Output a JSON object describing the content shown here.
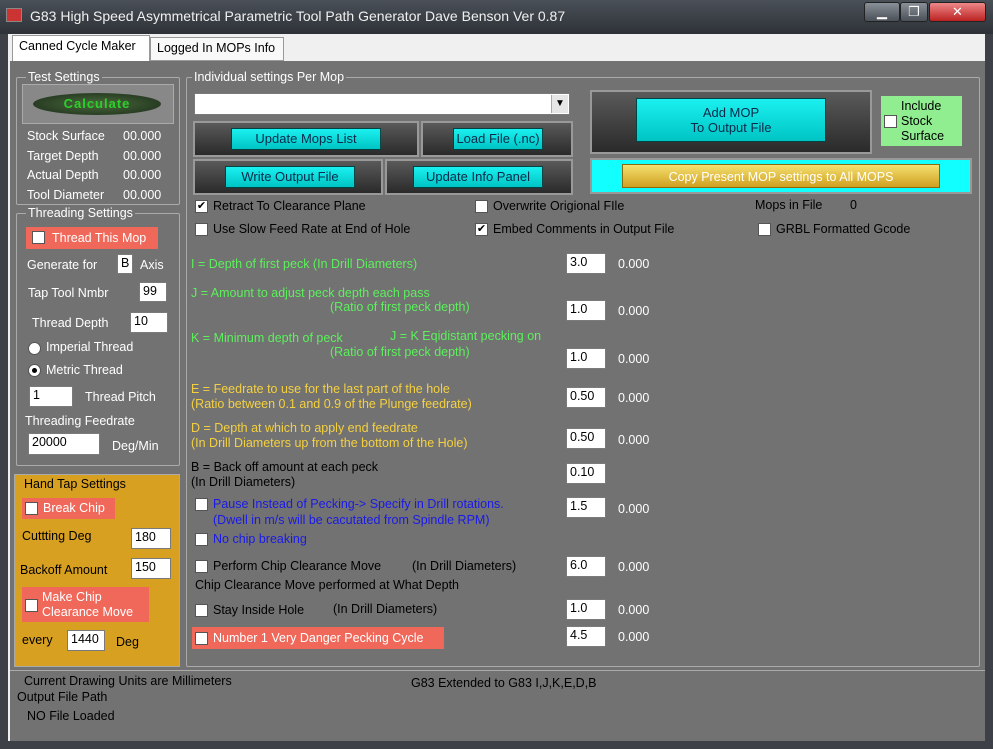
{
  "window": {
    "title": "G83 High Speed Asymmetrical Parametric Tool Path Generator Dave Benson Ver 0.87",
    "min": "▁",
    "max": "❐",
    "close": "✕"
  },
  "tabs": [
    "Canned Cycle Maker",
    "Logged In MOPs Info"
  ],
  "test": {
    "title": "Test Settings",
    "calculate": "Calculate",
    "rows": [
      {
        "label": "Stock Surface",
        "value": "00.000"
      },
      {
        "label": "Target Depth",
        "value": "00.000"
      },
      {
        "label": "Actual Depth",
        "value": "00.000"
      },
      {
        "label": "Tool Diameter",
        "value": "00.000"
      }
    ]
  },
  "thread": {
    "title": "Threading Settings",
    "this_mop": "Thread This Mop",
    "gen_for": "Generate for",
    "axis_val": "B",
    "axis": "Axis",
    "tap_tool": "Tap Tool Nmbr",
    "tap_val": "99",
    "depth": "Thread Depth",
    "depth_val": "10",
    "imperial": "Imperial Thread",
    "metric": "Metric Thread",
    "pitch_val": "1",
    "pitch": "Thread Pitch",
    "feed": "Threading Feedrate",
    "feed_val": "20000",
    "feed_unit": "Deg/Min"
  },
  "hand": {
    "title": "Hand Tap Settings",
    "break": "Break Chip",
    "cut_deg": "Cuttting Deg",
    "cut_val": "180",
    "backoff": "Backoff Amount",
    "backoff_val": "150",
    "make_chip": "Make  Chip",
    "clearance": "Clearance  Move",
    "every": "every",
    "every_val": "1440",
    "deg": "Deg"
  },
  "mop": {
    "title": "Individual settings Per Mop",
    "dropdown": "",
    "update_list": "Update Mops List",
    "load": "Load File (.nc)",
    "write": "Write Output File",
    "update_info": "Update Info Panel",
    "add_mop_1": "Add MOP",
    "add_mop_2": "To Output File",
    "include_1": "Include",
    "include_2": "Stock",
    "include_3": "Surface",
    "copy": "Copy Present MOP settings to All MOPS"
  },
  "checks": {
    "retract": "Retract To Clearance Plane",
    "overwrite": "Overwrite Origional FIle",
    "mops_in_file": "Mops in  File",
    "mops_count": "0",
    "slow_feed": "Use Slow Feed Rate at End of Hole",
    "embed": "Embed Comments in Output File",
    "grbl": "GRBL Formatted Gcode"
  },
  "params": [
    {
      "line1": "I    =  Depth of first peck  (In Drill Diameters)",
      "line2": "",
      "input": "3.0",
      "val": "0.000"
    },
    {
      "line1": "J   =  Amount to adjust  peck depth each pass",
      "line2": "(Ratio of first peck depth)",
      "input": "1.0",
      "val": "0.000"
    },
    {
      "line1": "K  =  Minimum depth of peck",
      "line1b": "J = K Eqidistant  pecking on",
      "line2": "(Ratio of first peck depth)",
      "input": "1.0",
      "val": "0.000"
    },
    {
      "line1": "E  =  Feedrate  to use for the last part of the hole",
      "line2": "(Ratio between 0.1 and 0.9 of the Plunge feedrate)",
      "input": "0.50",
      "val": "0.000"
    },
    {
      "line1": "D  =  Depth at which to apply end feedrate",
      "line2": "(In Drill Diameters up from the bottom of the Hole)",
      "input": "0.50",
      "val": "0.000"
    },
    {
      "line1": "B  =  Back off amount at each peck",
      "line2": "(In Drill Diameters)",
      "input": "0.10",
      "val": ""
    }
  ],
  "pause": {
    "line1": "Pause Instead of Pecking-> Specify in Drill rotations.",
    "line2": "(Dwell in m/s will be cacutated from Spindle RPM)",
    "input": "1.5",
    "val": "0.000"
  },
  "no_chip": "No chip breaking",
  "chip_clear": {
    "label": "Perform Chip Clearance Move",
    "unit": "(In Drill Diameters)",
    "sub": "Chip Clearance Move  performed at  What Depth",
    "input": "6.0",
    "val": "0.000"
  },
  "stay": {
    "label": "Stay Inside Hole",
    "unit": "(In Drill Diameters)",
    "input": "1.0",
    "val": "0.000"
  },
  "danger": {
    "label": "Number 1 Very Danger Pecking Cycle",
    "input": "4.5",
    "val": "0.000"
  },
  "status": {
    "units": "Current Drawing Units are Millimeters",
    "output_label": "Output File Path",
    "file": "NO File Loaded",
    "g83": "G83 Extended to G83 I,J,K,E,D,B"
  },
  "colors": {
    "cyan": "#00dede",
    "panel": "#727272",
    "hand": "#d8a020",
    "red": "#f0685a",
    "green_label": "#5cf05c",
    "yellow_label": "#f4d040"
  }
}
